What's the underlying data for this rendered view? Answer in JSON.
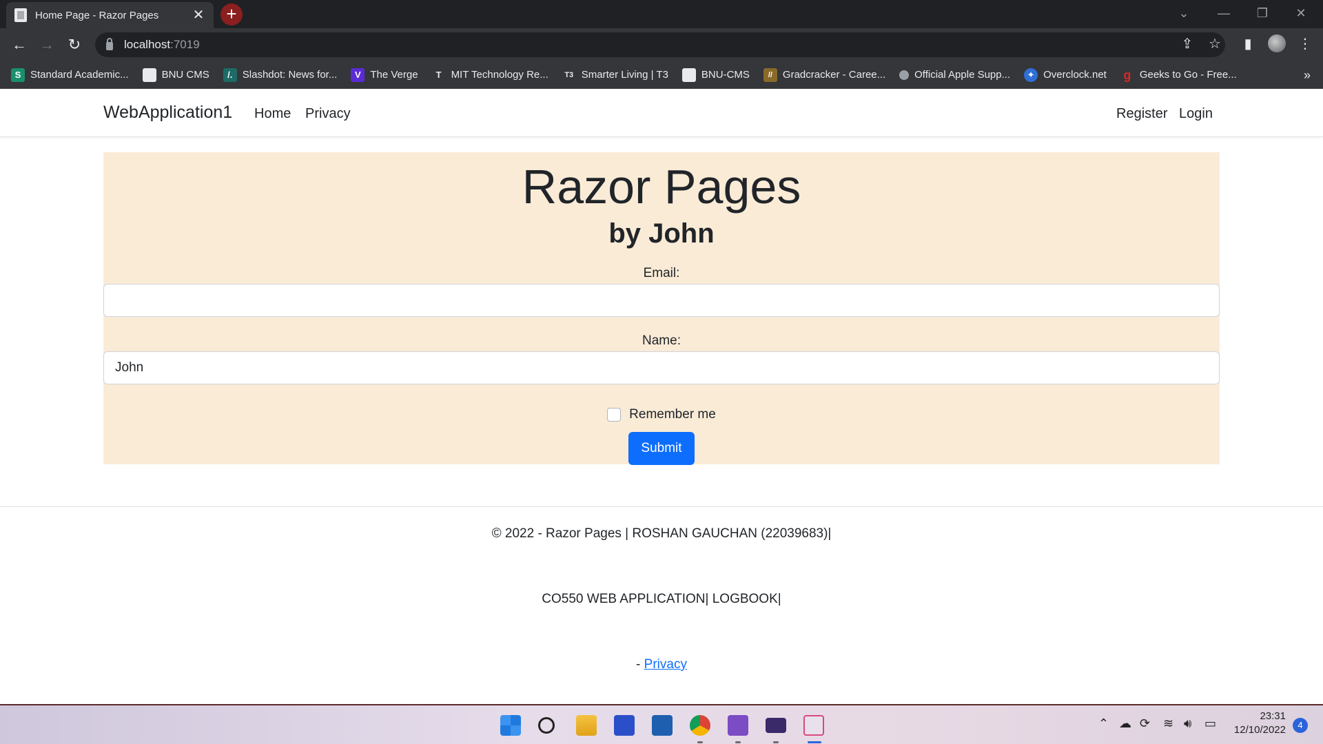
{
  "browser": {
    "tab_title": "Home Page - Razor Pages",
    "tab_close": "✕",
    "new_tab": "+",
    "url_host": "localhost",
    "url_port": ":7019",
    "bookmarks": [
      {
        "label": "Standard Academic...",
        "color": "#1a8f6e",
        "glyph": "S"
      },
      {
        "label": "BNU CMS",
        "color": "#e8eaed",
        "glyph": ""
      },
      {
        "label": "Slashdot: News for...",
        "color": "#1d6b66",
        "glyph": "/."
      },
      {
        "label": "The Verge",
        "color": "#5b2bd6",
        "glyph": "V"
      },
      {
        "label": "MIT Technology Re...",
        "color": "#e8eaed",
        "glyph": "T"
      },
      {
        "label": "Smarter Living | T3",
        "color": "#e8eaed",
        "glyph": "T3"
      },
      {
        "label": "BNU-CMS",
        "color": "#e8eaed",
        "glyph": ""
      },
      {
        "label": "Gradcracker - Caree...",
        "color": "#8a6a2a",
        "glyph": "//"
      },
      {
        "label": "Official Apple Supp...",
        "color": "#9aa0a6",
        "glyph": ""
      },
      {
        "label": "Overclock.net",
        "color": "#2f6fd8",
        "glyph": "✦"
      },
      {
        "label": "Geeks to Go - Free...",
        "color": "#d62828",
        "glyph": "g"
      }
    ],
    "bookmarks_more": "»"
  },
  "navbar": {
    "brand": "WebApplication1",
    "links": [
      "Home",
      "Privacy"
    ],
    "right_links": [
      "Register",
      "Login"
    ]
  },
  "hero": {
    "title": "Razor Pages",
    "subtitle": "by John",
    "email_label": "Email:",
    "email_value": "",
    "name_label": "Name:",
    "name_value": "John",
    "remember_label": "Remember me",
    "remember_checked": false,
    "submit_label": "Submit"
  },
  "footer": {
    "line1": "© 2022 - Razor Pages | ROSHAN GAUCHAN (22039683)|",
    "line2": "CO550 WEB APPLICATION| LOGBOOK|",
    "line3_prefix": "- ",
    "line3_link": "Privacy"
  },
  "taskbar": {
    "time": "23:31",
    "date": "12/10/2022",
    "notifications": "4"
  },
  "colors": {
    "hero_bg": "#faebd7",
    "primary": "#0d6efd",
    "chrome_dark": "#202124"
  }
}
